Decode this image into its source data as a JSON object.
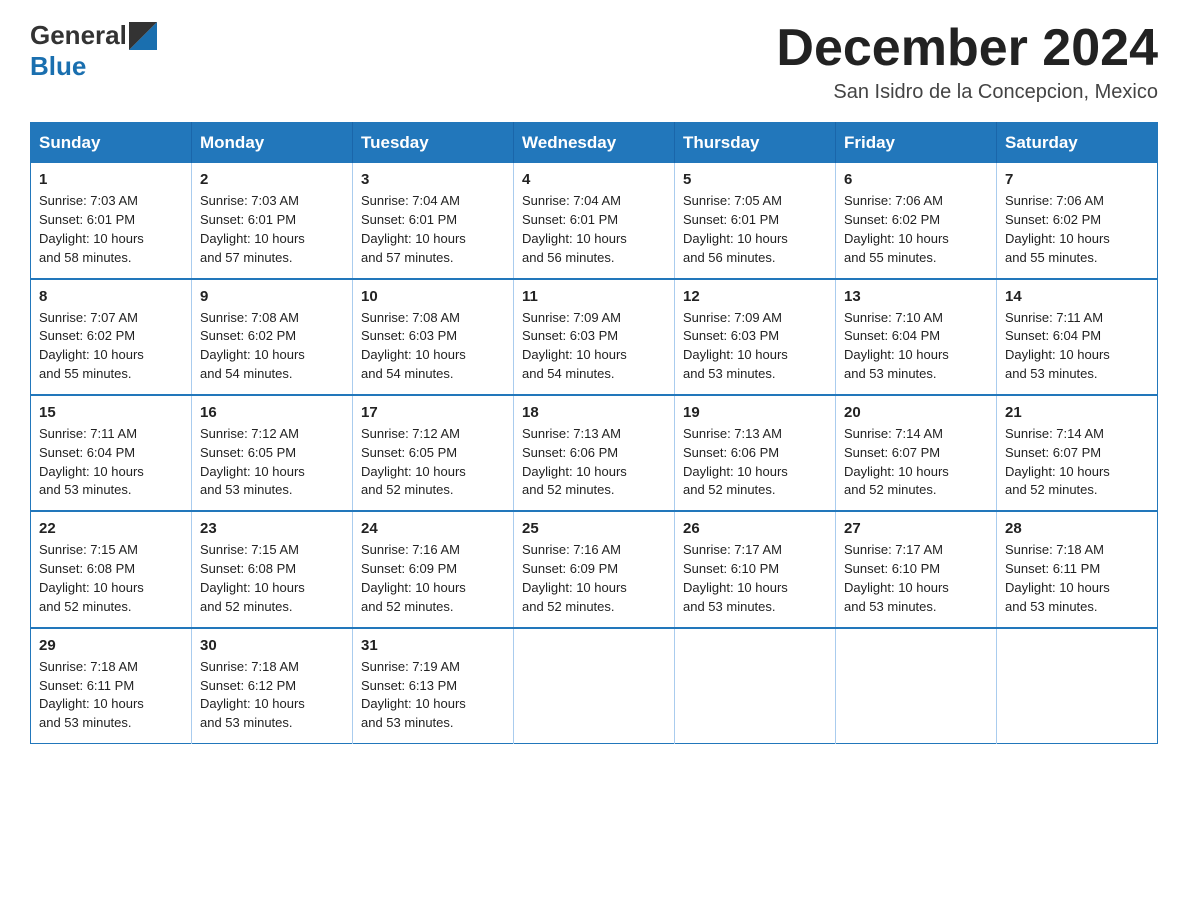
{
  "header": {
    "logo_general": "General",
    "logo_blue": "Blue",
    "month_title": "December 2024",
    "location": "San Isidro de la Concepcion, Mexico"
  },
  "days_of_week": [
    "Sunday",
    "Monday",
    "Tuesday",
    "Wednesday",
    "Thursday",
    "Friday",
    "Saturday"
  ],
  "weeks": [
    [
      {
        "day": "1",
        "sunrise": "7:03 AM",
        "sunset": "6:01 PM",
        "daylight": "10 hours and 58 minutes."
      },
      {
        "day": "2",
        "sunrise": "7:03 AM",
        "sunset": "6:01 PM",
        "daylight": "10 hours and 57 minutes."
      },
      {
        "day": "3",
        "sunrise": "7:04 AM",
        "sunset": "6:01 PM",
        "daylight": "10 hours and 57 minutes."
      },
      {
        "day": "4",
        "sunrise": "7:04 AM",
        "sunset": "6:01 PM",
        "daylight": "10 hours and 56 minutes."
      },
      {
        "day": "5",
        "sunrise": "7:05 AM",
        "sunset": "6:01 PM",
        "daylight": "10 hours and 56 minutes."
      },
      {
        "day": "6",
        "sunrise": "7:06 AM",
        "sunset": "6:02 PM",
        "daylight": "10 hours and 55 minutes."
      },
      {
        "day": "7",
        "sunrise": "7:06 AM",
        "sunset": "6:02 PM",
        "daylight": "10 hours and 55 minutes."
      }
    ],
    [
      {
        "day": "8",
        "sunrise": "7:07 AM",
        "sunset": "6:02 PM",
        "daylight": "10 hours and 55 minutes."
      },
      {
        "day": "9",
        "sunrise": "7:08 AM",
        "sunset": "6:02 PM",
        "daylight": "10 hours and 54 minutes."
      },
      {
        "day": "10",
        "sunrise": "7:08 AM",
        "sunset": "6:03 PM",
        "daylight": "10 hours and 54 minutes."
      },
      {
        "day": "11",
        "sunrise": "7:09 AM",
        "sunset": "6:03 PM",
        "daylight": "10 hours and 54 minutes."
      },
      {
        "day": "12",
        "sunrise": "7:09 AM",
        "sunset": "6:03 PM",
        "daylight": "10 hours and 53 minutes."
      },
      {
        "day": "13",
        "sunrise": "7:10 AM",
        "sunset": "6:04 PM",
        "daylight": "10 hours and 53 minutes."
      },
      {
        "day": "14",
        "sunrise": "7:11 AM",
        "sunset": "6:04 PM",
        "daylight": "10 hours and 53 minutes."
      }
    ],
    [
      {
        "day": "15",
        "sunrise": "7:11 AM",
        "sunset": "6:04 PM",
        "daylight": "10 hours and 53 minutes."
      },
      {
        "day": "16",
        "sunrise": "7:12 AM",
        "sunset": "6:05 PM",
        "daylight": "10 hours and 53 minutes."
      },
      {
        "day": "17",
        "sunrise": "7:12 AM",
        "sunset": "6:05 PM",
        "daylight": "10 hours and 52 minutes."
      },
      {
        "day": "18",
        "sunrise": "7:13 AM",
        "sunset": "6:06 PM",
        "daylight": "10 hours and 52 minutes."
      },
      {
        "day": "19",
        "sunrise": "7:13 AM",
        "sunset": "6:06 PM",
        "daylight": "10 hours and 52 minutes."
      },
      {
        "day": "20",
        "sunrise": "7:14 AM",
        "sunset": "6:07 PM",
        "daylight": "10 hours and 52 minutes."
      },
      {
        "day": "21",
        "sunrise": "7:14 AM",
        "sunset": "6:07 PM",
        "daylight": "10 hours and 52 minutes."
      }
    ],
    [
      {
        "day": "22",
        "sunrise": "7:15 AM",
        "sunset": "6:08 PM",
        "daylight": "10 hours and 52 minutes."
      },
      {
        "day": "23",
        "sunrise": "7:15 AM",
        "sunset": "6:08 PM",
        "daylight": "10 hours and 52 minutes."
      },
      {
        "day": "24",
        "sunrise": "7:16 AM",
        "sunset": "6:09 PM",
        "daylight": "10 hours and 52 minutes."
      },
      {
        "day": "25",
        "sunrise": "7:16 AM",
        "sunset": "6:09 PM",
        "daylight": "10 hours and 52 minutes."
      },
      {
        "day": "26",
        "sunrise": "7:17 AM",
        "sunset": "6:10 PM",
        "daylight": "10 hours and 53 minutes."
      },
      {
        "day": "27",
        "sunrise": "7:17 AM",
        "sunset": "6:10 PM",
        "daylight": "10 hours and 53 minutes."
      },
      {
        "day": "28",
        "sunrise": "7:18 AM",
        "sunset": "6:11 PM",
        "daylight": "10 hours and 53 minutes."
      }
    ],
    [
      {
        "day": "29",
        "sunrise": "7:18 AM",
        "sunset": "6:11 PM",
        "daylight": "10 hours and 53 minutes."
      },
      {
        "day": "30",
        "sunrise": "7:18 AM",
        "sunset": "6:12 PM",
        "daylight": "10 hours and 53 minutes."
      },
      {
        "day": "31",
        "sunrise": "7:19 AM",
        "sunset": "6:13 PM",
        "daylight": "10 hours and 53 minutes."
      },
      null,
      null,
      null,
      null
    ]
  ],
  "labels": {
    "sunrise": "Sunrise:",
    "sunset": "Sunset:",
    "daylight": "Daylight:"
  }
}
